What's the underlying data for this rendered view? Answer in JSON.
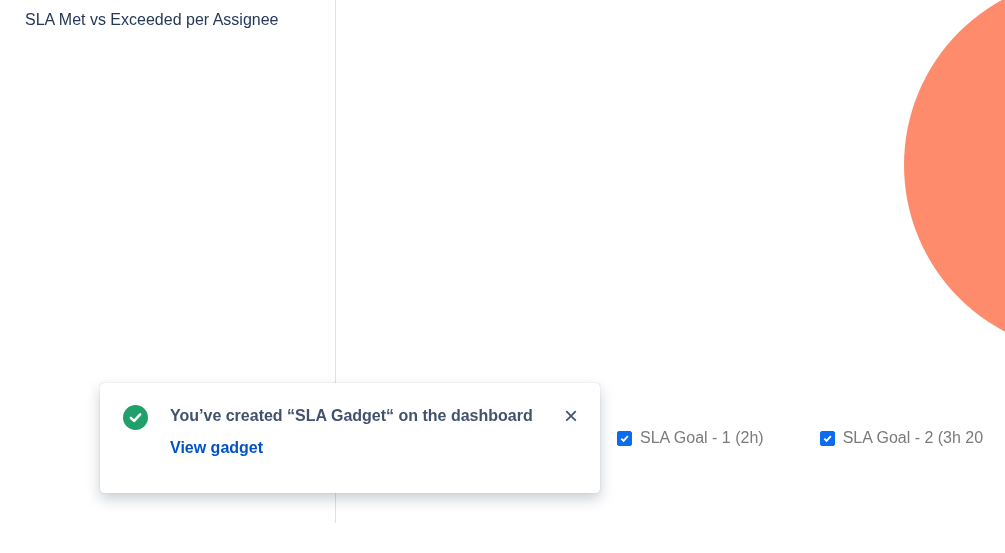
{
  "sidebar": {
    "title": "SLA Met vs Exceeded per Assignee"
  },
  "chart": {
    "legend": [
      {
        "label": "SLA Goal - 1 (2h)",
        "checked": true
      },
      {
        "label": "SLA Goal - 2 (3h 20",
        "checked": true
      }
    ]
  },
  "toast": {
    "message": "You’ve created “SLA Gadget“ on the dashboard",
    "link": "View gadget",
    "close": "×"
  }
}
